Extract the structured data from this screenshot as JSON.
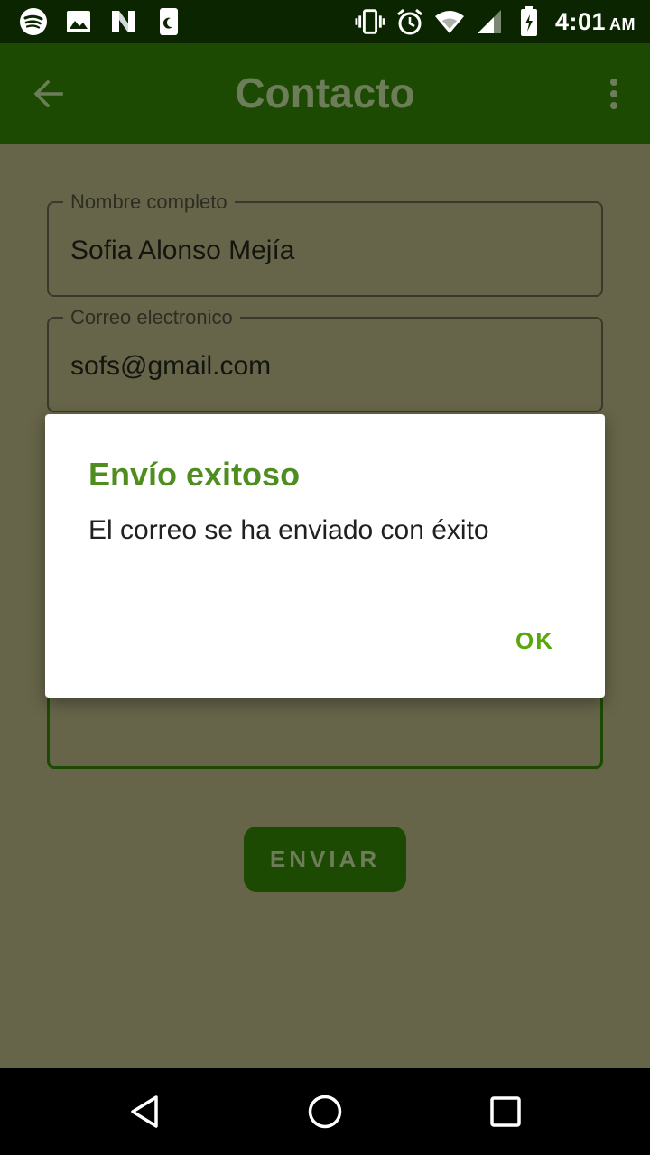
{
  "status_bar": {
    "time": "4:01",
    "ampm": "AM",
    "left_icons": [
      "spotify-icon",
      "image-icon",
      "notification-n-icon",
      "night-mode-icon"
    ],
    "right_icons": [
      "vibrate-icon",
      "alarm-icon",
      "wifi-icon",
      "signal-icon",
      "battery-icon"
    ]
  },
  "app_bar": {
    "title": "Contacto",
    "back_icon": "arrow-left-icon",
    "overflow_icon": "more-vert-icon"
  },
  "form": {
    "name_label": "Nombre completo",
    "name_value": "Sofia Alonso Mejía",
    "email_label": "Correo electronico",
    "email_value": "sofs@gmail.com",
    "send_label": "ENVIAR"
  },
  "dialog": {
    "title": "Envío exitoso",
    "message": "El correo se ha enviado con éxito",
    "ok_label": "OK"
  },
  "colors": {
    "app_bar": "#1d4a02",
    "status_bar": "#0b2500",
    "scrim_background": "#666549",
    "dialog_title": "#4f8d21",
    "dialog_button": "#5aa70a"
  },
  "nav_bar": {
    "icons": [
      "nav-back-icon",
      "nav-home-icon",
      "nav-recents-icon"
    ]
  }
}
